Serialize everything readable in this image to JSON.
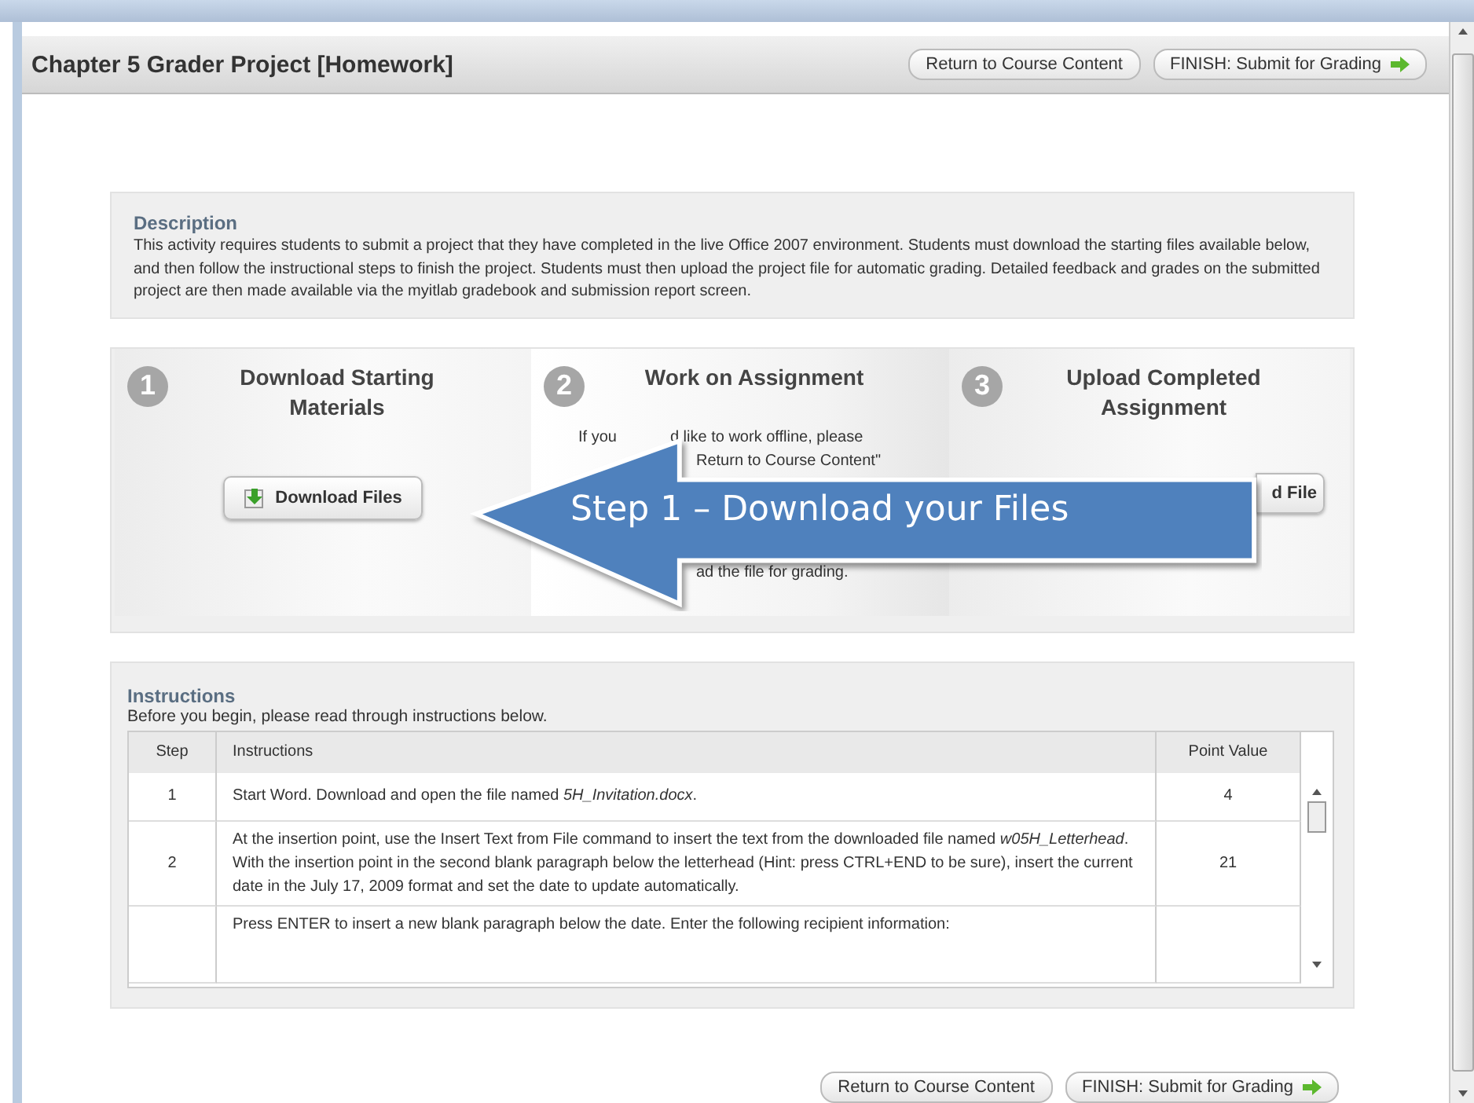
{
  "page": {
    "title": "Chapter 5 Grader Project [Homework]",
    "buttons": [
      {
        "label": "Return to Course Content",
        "kind": "plain"
      },
      {
        "label": "FINISH: Submit for Grading",
        "kind": "finish"
      }
    ]
  },
  "description": {
    "heading": "Description",
    "text": "This activity requires students to submit a project that they have completed in the live Office 2007 environment. Students must download the starting files available below, and then follow the instructional steps to finish the project. Students must then upload the project file for automatic grading. Detailed feedback and grades on the submitted project are then made available via the myitlab gradebook and submission report screen."
  },
  "steps": [
    {
      "number": "1",
      "title": "Download Starting Materials",
      "button": {
        "label": "Download Files",
        "kind": "download"
      }
    },
    {
      "number": "2",
      "title": "Work on Assignment",
      "lines": [
        [
          "If you",
          "d like to work offline, please"
        ],
        [
          "Return to Course Content\""
        ],
        [
          "ad the file for grading."
        ]
      ]
    },
    {
      "number": "3",
      "title": "Upload Completed Assignment",
      "button": {
        "label": "d File",
        "kind": "upload"
      }
    }
  ],
  "callout": {
    "text": "Step 1 – Download your Files"
  },
  "instructions": {
    "heading": "Instructions",
    "subtitle": "Before you begin, please read through instructions below.",
    "columns": [
      "Step",
      "Instructions",
      "Point Value"
    ],
    "rows": [
      {
        "step": "1",
        "text": "Start Word. Download and open the file named *5H_Invitation.docx*.",
        "points": "4"
      },
      {
        "step": "2",
        "text": "At the insertion point, use the Insert Text from File command to insert the text from the downloaded file named *w05H_Letterhead*. With the insertion point in the second blank paragraph below the letterhead (Hint: press CTRL+END to be sure), insert the current date in the July 17, 2009 format and set the date to update automatically.",
        "points": "21"
      },
      {
        "step": "",
        "text": "Press ENTER to insert a new blank paragraph below the date. Enter the following recipient information:",
        "points": ""
      }
    ]
  },
  "footer_buttons": [
    {
      "label": "Return to Course Content",
      "kind": "plain"
    },
    {
      "label": "FINISH: Submit for Grading",
      "kind": "finish"
    }
  ]
}
